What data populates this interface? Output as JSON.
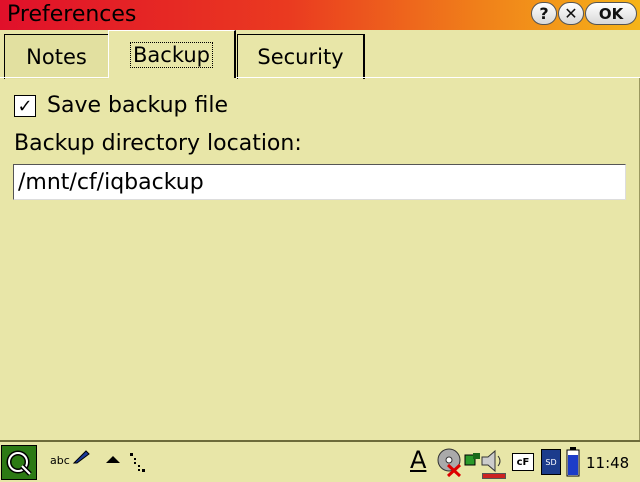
{
  "window": {
    "title": "Preferences",
    "help_label": "?",
    "close_label": "✕",
    "ok_label": "OK"
  },
  "tabs": [
    {
      "label": "Notes",
      "active": false
    },
    {
      "label": "Backup",
      "active": true
    },
    {
      "label": "Security",
      "active": false
    }
  ],
  "backup": {
    "save_backup_label": "Save backup file",
    "save_backup_checked": true,
    "check_glyph": "✓",
    "directory_label": "Backup directory location:",
    "directory_value": "/mnt/cf/iqbackup"
  },
  "taskbar": {
    "input_method_label": "abc",
    "clock": "11:48",
    "font_indicator": "A",
    "cf_label": "cF",
    "sd_label": "SD",
    "icons": [
      "q-launcher-icon",
      "handwriting-pen-icon",
      "up-arrow-icon",
      "dots-menu-icon",
      "font-icon",
      "cd-icon",
      "network-icon",
      "speaker-icon",
      "cf-card-icon",
      "sd-card-icon",
      "battery-icon"
    ]
  },
  "colors": {
    "background": "#e8e6a8",
    "titlebar_start": "#e0102a",
    "titlebar_end": "#f6b418",
    "launcher_green": "#2c7a14"
  }
}
